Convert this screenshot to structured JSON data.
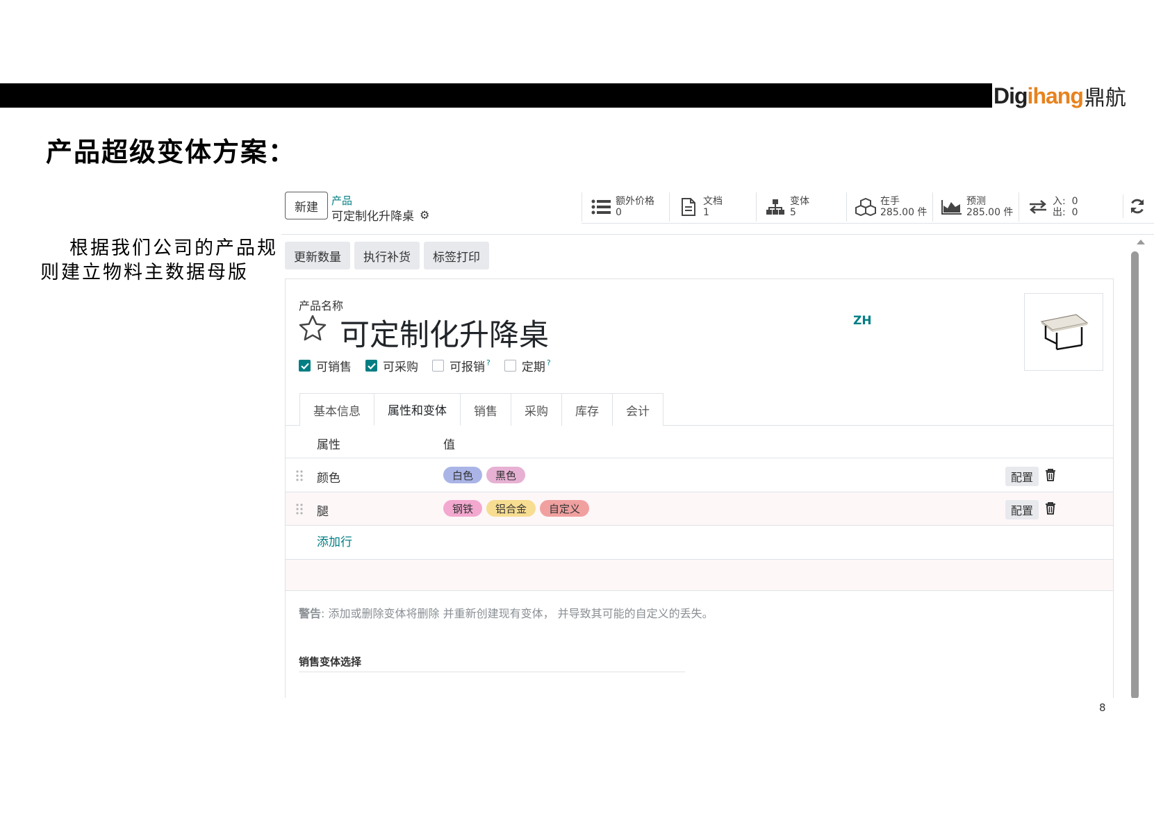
{
  "slide": {
    "logo_part1": "Dig",
    "logo_part2": "ihang",
    "logo_part3": "鼎航",
    "title": "产品超级变体方案：",
    "description": "根据我们公司的产品规则建立物料主数据母版",
    "page_number": "8"
  },
  "control_panel": {
    "new_label": "新建",
    "breadcrumb_parent": "产品",
    "breadcrumb_current": "可定制化升降桌",
    "smart_buttons": [
      {
        "icon": "list-icon",
        "label": "额外价格",
        "value": "0"
      },
      {
        "icon": "document-icon",
        "label": "文档",
        "value": "1"
      },
      {
        "icon": "sitemap-icon",
        "label": "变体",
        "value": "5"
      },
      {
        "icon": "cubes-icon",
        "label": "在手",
        "value": "285.00 件"
      },
      {
        "icon": "area-chart-icon",
        "label": "预测",
        "value": "285.00 件"
      }
    ],
    "in_out": {
      "in_label": "入:",
      "in_value": "0",
      "out_label": "出:",
      "out_value": "0"
    }
  },
  "actions": [
    "更新数量",
    "执行补货",
    "标签打印"
  ],
  "form": {
    "name_label": "产品名称",
    "product_name": "可定制化升降桌",
    "lang": "ZH",
    "checkboxes": [
      {
        "label": "可销售",
        "checked": true,
        "help": ""
      },
      {
        "label": "可采购",
        "checked": true,
        "help": ""
      },
      {
        "label": "可报销",
        "checked": false,
        "help": "?"
      },
      {
        "label": "定期",
        "checked": false,
        "help": "?"
      }
    ],
    "tabs": [
      "基本信息",
      "属性和变体",
      "销售",
      "采购",
      "库存",
      "会计"
    ],
    "active_tab": 1,
    "table": {
      "headers": [
        "属性",
        "值"
      ],
      "rows": [
        {
          "name": "颜色",
          "values": [
            {
              "label": "白色",
              "color": "#aab4e6"
            },
            {
              "label": "黑色",
              "color": "#e7b1d3"
            }
          ],
          "config_label": "配置"
        },
        {
          "name": "腿",
          "values": [
            {
              "label": "钢铁",
              "color": "#f3a8cf"
            },
            {
              "label": "铝合金",
              "color": "#f7dd91"
            },
            {
              "label": "自定义",
              "color": "#f1a0a0"
            }
          ],
          "config_label": "配置"
        }
      ],
      "add_line": "添加行"
    },
    "warning_label": "警告",
    "warning_text": ": 添加或删除变体将删除 并重新创建现有变体， 并导致其可能的自定义的丢失。",
    "section_title": "销售变体选择"
  },
  "colors": {
    "accent": "#017e84",
    "button_bg": "#e7e9ed"
  }
}
